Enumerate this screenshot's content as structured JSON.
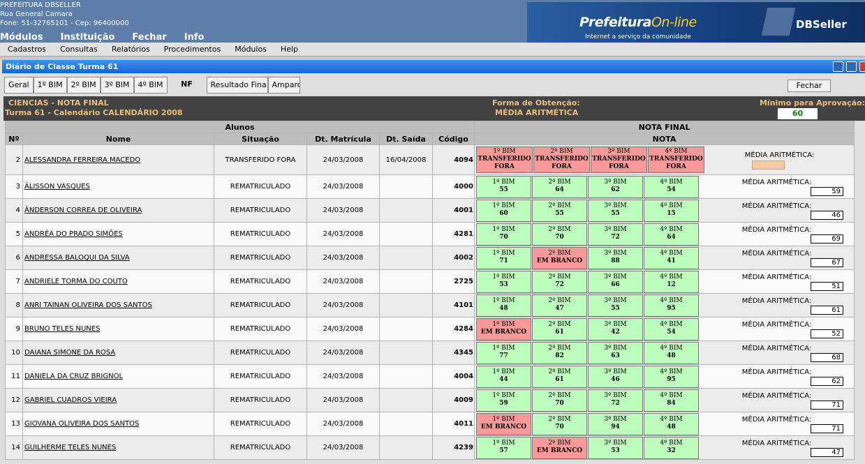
{
  "header": {
    "org_name": "PREFEITURA DBSELLER",
    "address": "Rua General Camara",
    "phone": "Fone: 51-32765101  -  Cep: 96400000",
    "main_menu": [
      "Módulos",
      "Instituição",
      "Fechar",
      "Info"
    ],
    "brand_part1": "Prefeitura",
    "brand_part2": "On-line",
    "tagline": "Internet a serviço da comunidade",
    "vendor": "DBSeller"
  },
  "menubar": [
    "Cadastros",
    "Consultas",
    "Relatórios",
    "Procedimentos",
    "Módulos",
    "Help"
  ],
  "window": {
    "title": "Diário de Classe Turma 61",
    "tabs": [
      "Geral",
      "1º BIM",
      "2º BIM",
      "3º BIM",
      "4º BIM",
      "NF",
      "Resultado Fina",
      "Amparo"
    ],
    "close_label": "Fechar"
  },
  "info": {
    "subject": "CIENCIAS - NOTA FINAL",
    "turma": "Turma 61 - Calendário CALENDÁRIO 2008",
    "forma_label": "Forma de Obtenção:",
    "forma_value": "MÉDIA ARITMÉTICA",
    "minimo_label": "Mínimo para Aprovação:",
    "minimo_value": "60"
  },
  "table": {
    "group_alunos": "Alunos",
    "group_nota_final": "NOTA FINAL",
    "headers": [
      "Nº",
      "Nome",
      "Situação",
      "Dt. Matrícula",
      "Dt. Saída",
      "Código",
      "NOTA"
    ],
    "media_label": "MÉDIA ARITMÉTICA:",
    "rows": [
      {
        "n": "2",
        "nome": "ALESSANDRA FERREIRA MACEDO",
        "situacao": "TRANSFERIDO FORA",
        "matricula": "24/03/2008",
        "saida": "16/04/2008",
        "codigo": "4094",
        "grades": [
          {
            "b": "1º BIM",
            "v": "TRANSFERIDO FORA",
            "s": "bad"
          },
          {
            "b": "2º BIM",
            "v": "TRANSFERIDO FORA",
            "s": "bad"
          },
          {
            "b": "3º BIM",
            "v": "TRANSFERIDO FORA",
            "s": "bad"
          },
          {
            "b": "4º BIM",
            "v": "TRANSFERIDO FORA",
            "s": "bad"
          }
        ],
        "media": ""
      },
      {
        "n": "3",
        "nome": "ÁLISSON VASQUES",
        "situacao": "REMATRICULADO",
        "matricula": "24/03/2008",
        "saida": "",
        "codigo": "4000",
        "grades": [
          {
            "b": "1º BIM",
            "v": "55",
            "s": "ok"
          },
          {
            "b": "2º BIM",
            "v": "64",
            "s": "ok"
          },
          {
            "b": "3º BIM",
            "v": "62",
            "s": "ok"
          },
          {
            "b": "4º BIM",
            "v": "54",
            "s": "ok"
          }
        ],
        "media": "59"
      },
      {
        "n": "4",
        "nome": "ÂNDERSON CORREA DE OLIVEIRA",
        "situacao": "REMATRICULADO",
        "matricula": "24/03/2008",
        "saida": "",
        "codigo": "4001",
        "grades": [
          {
            "b": "1º BIM",
            "v": "60",
            "s": "ok"
          },
          {
            "b": "2º BIM",
            "v": "55",
            "s": "ok"
          },
          {
            "b": "3º BIM",
            "v": "55",
            "s": "ok"
          },
          {
            "b": "4º BIM",
            "v": "15",
            "s": "ok"
          }
        ],
        "media": "46"
      },
      {
        "n": "5",
        "nome": "ANDRÉA DO PRADO SIMÕES",
        "situacao": "REMATRICULADO",
        "matricula": "24/03/2008",
        "saida": "",
        "codigo": "4281",
        "grades": [
          {
            "b": "1º BIM",
            "v": "70",
            "s": "ok"
          },
          {
            "b": "2º BIM",
            "v": "70",
            "s": "ok"
          },
          {
            "b": "3º BIM",
            "v": "72",
            "s": "ok"
          },
          {
            "b": "4º BIM",
            "v": "64",
            "s": "ok"
          }
        ],
        "media": "69"
      },
      {
        "n": "6",
        "nome": "ANDRESSA BALOQUI DA SILVA",
        "situacao": "REMATRICULADO",
        "matricula": "24/03/2008",
        "saida": "",
        "codigo": "4002",
        "grades": [
          {
            "b": "1º BIM",
            "v": "71",
            "s": "ok"
          },
          {
            "b": "2º BIM",
            "v": "EM BRANCO",
            "s": "bad"
          },
          {
            "b": "3º BIM",
            "v": "88",
            "s": "ok"
          },
          {
            "b": "4º BIM",
            "v": "41",
            "s": "ok"
          }
        ],
        "media": "67"
      },
      {
        "n": "7",
        "nome": "ANDRIELE TORMA DO COUTO",
        "situacao": "REMATRICULADO",
        "matricula": "24/03/2008",
        "saida": "",
        "codigo": "2725",
        "grades": [
          {
            "b": "1º BIM",
            "v": "53",
            "s": "ok"
          },
          {
            "b": "2º BIM",
            "v": "72",
            "s": "ok"
          },
          {
            "b": "3º BIM",
            "v": "66",
            "s": "ok"
          },
          {
            "b": "4º BIM",
            "v": "12",
            "s": "ok"
          }
        ],
        "media": "51"
      },
      {
        "n": "8",
        "nome": "ANRI TAINAN OLIVEIRA DOS SANTOS",
        "situacao": "REMATRICULADO",
        "matricula": "24/03/2008",
        "saida": "",
        "codigo": "4101",
        "grades": [
          {
            "b": "1º BIM",
            "v": "48",
            "s": "ok"
          },
          {
            "b": "2º BIM",
            "v": "47",
            "s": "ok"
          },
          {
            "b": "3º BIM",
            "v": "55",
            "s": "ok"
          },
          {
            "b": "4º BIM",
            "v": "95",
            "s": "ok"
          }
        ],
        "media": "61"
      },
      {
        "n": "9",
        "nome": "BRUNO TELES NUNES",
        "situacao": "REMATRICULADO",
        "matricula": "24/03/2008",
        "saida": "",
        "codigo": "4284",
        "grades": [
          {
            "b": "1º BIM",
            "v": "EM BRANCO",
            "s": "bad"
          },
          {
            "b": "2º BIM",
            "v": "61",
            "s": "ok"
          },
          {
            "b": "3º BIM",
            "v": "42",
            "s": "ok"
          },
          {
            "b": "4º BIM",
            "v": "54",
            "s": "ok"
          }
        ],
        "media": "52"
      },
      {
        "n": "10",
        "nome": "DAIANA SIMONE DA ROSA",
        "situacao": "REMATRICULADO",
        "matricula": "24/03/2008",
        "saida": "",
        "codigo": "4345",
        "grades": [
          {
            "b": "1º BIM",
            "v": "77",
            "s": "ok"
          },
          {
            "b": "2º BIM",
            "v": "82",
            "s": "ok"
          },
          {
            "b": "3º BIM",
            "v": "63",
            "s": "ok"
          },
          {
            "b": "4º BIM",
            "v": "48",
            "s": "ok"
          }
        ],
        "media": "68"
      },
      {
        "n": "11",
        "nome": "DANIELA DA CRUZ BRIGNOL",
        "situacao": "REMATRICULADO",
        "matricula": "24/03/2008",
        "saida": "",
        "codigo": "4004",
        "grades": [
          {
            "b": "1º BIM",
            "v": "44",
            "s": "ok"
          },
          {
            "b": "2º BIM",
            "v": "61",
            "s": "ok"
          },
          {
            "b": "3º BIM",
            "v": "46",
            "s": "ok"
          },
          {
            "b": "4º BIM",
            "v": "95",
            "s": "ok"
          }
        ],
        "media": "62"
      },
      {
        "n": "12",
        "nome": "GABRIEL CUADROS VIEIRA",
        "situacao": "REMATRICULADO",
        "matricula": "24/03/2008",
        "saida": "",
        "codigo": "4009",
        "grades": [
          {
            "b": "1º BIM",
            "v": "59",
            "s": "ok"
          },
          {
            "b": "2º BIM",
            "v": "70",
            "s": "ok"
          },
          {
            "b": "3º BIM",
            "v": "72",
            "s": "ok"
          },
          {
            "b": "4º BIM",
            "v": "84",
            "s": "ok"
          }
        ],
        "media": "71"
      },
      {
        "n": "13",
        "nome": "GIOVANA OLIVEIRA DOS SANTOS",
        "situacao": "REMATRICULADO",
        "matricula": "24/03/2008",
        "saida": "",
        "codigo": "4011",
        "grades": [
          {
            "b": "1º BIM",
            "v": "EM BRANCO",
            "s": "bad"
          },
          {
            "b": "2º BIM",
            "v": "70",
            "s": "ok"
          },
          {
            "b": "3º BIM",
            "v": "94",
            "s": "ok"
          },
          {
            "b": "4º BIM",
            "v": "48",
            "s": "ok"
          }
        ],
        "media": "71"
      },
      {
        "n": "14",
        "nome": "GUILHERME TELES NUNES",
        "situacao": "REMATRICULADO",
        "matricula": "24/03/2008",
        "saida": "",
        "codigo": "4239",
        "grades": [
          {
            "b": "1º BIM",
            "v": "57",
            "s": "ok"
          },
          {
            "b": "2º BIM",
            "v": "EM BRANCO",
            "s": "bad"
          },
          {
            "b": "3º BIM",
            "v": "53",
            "s": "ok"
          },
          {
            "b": "4º BIM",
            "v": "32",
            "s": "ok"
          }
        ],
        "media": "47"
      }
    ]
  }
}
